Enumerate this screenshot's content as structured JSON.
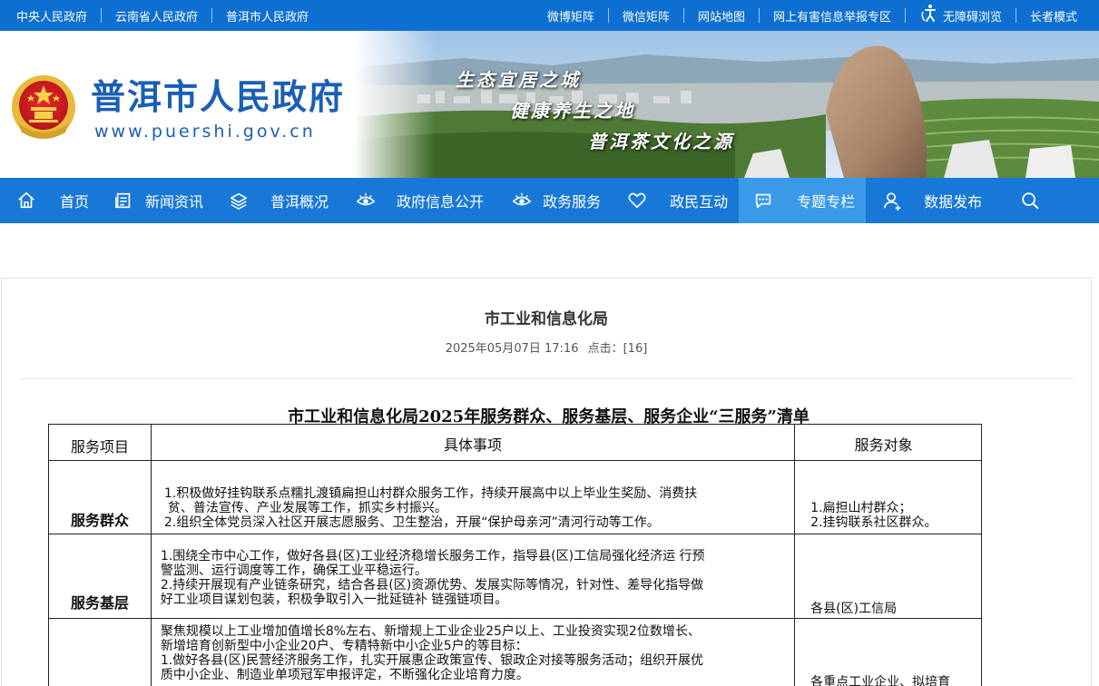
{
  "topbar": {
    "left_links": [
      "中央人民政府",
      "云南省人民政府",
      "普洱市人民政府"
    ],
    "right_links": [
      "微博矩阵",
      "微信矩阵",
      "网站地图",
      "网上有害信息举报专区"
    ],
    "accessibility": "无障碍浏览",
    "elder_mode": "长者模式"
  },
  "header": {
    "site_title": "普洱市人民政府",
    "site_url": "www.puershi.gov.cn",
    "slogans": [
      "生态宜居之城",
      "健康养生之地",
      "普洱茶文化之源"
    ]
  },
  "nav": {
    "items": [
      {
        "label": "首页",
        "icon": "home-icon"
      },
      {
        "label": "新闻资讯",
        "icon": "news-icon"
      },
      {
        "label": "普洱概况",
        "icon": "layers-icon"
      },
      {
        "label": "政府信息公开",
        "icon": "eye-icon"
      },
      {
        "label": "政务服务",
        "icon": "eye-icon"
      },
      {
        "label": "政民互动",
        "icon": "heart-icon"
      },
      {
        "label": "专题专栏",
        "icon": "chat-icon"
      },
      {
        "label": "数据发布",
        "icon": "user-icon"
      }
    ],
    "active_index": 6,
    "search_icon": "search-icon"
  },
  "article": {
    "title": "市工业和信息化局",
    "date": "2025年05月07日 17:16",
    "clicks_label": "点击：[16]"
  },
  "document": {
    "title": "市工业和信息化局2025年服务群众、服务基层、服务企业“三服务”清单",
    "headers": [
      "服务项目",
      "具体事项",
      "服务对象"
    ],
    "rows": [
      {
        "item": "服务群众",
        "details": [
          "1.积极做好挂钩联系点糯扎渡镇扁担山村群众服务工作，持续开展高中以上毕业生奖励、消费扶",
          "贫、普法宣传、产业发展等工作，抓实乡村振兴。",
          "2.组织全体党员深入社区开展志愿服务、卫生整治，开展“保护母亲河”清河行动等工作。"
        ],
        "targets": [
          "1.扁担山村群众；",
          "2.挂钩联系社区群众。"
        ]
      },
      {
        "item": "服务基层",
        "details": [
          "1.围绕全市中心工作，做好各县(区)工业经济稳增长服务工作，指导县(区)工信局强化经济运 行预",
          "警监测、运行调度等工作，确保工业平稳运行。",
          "2.持续开展现有产业链条研究，结合各县(区)资源优势、发展实际等情况，针对性、差导化指导做",
          "好工业项目谋划包装，积极争取引入一批延链补 链强链项目。"
        ],
        "targets": [
          "各县(区)工信局"
        ]
      },
      {
        "item": "",
        "details": [
          "聚焦规模以上工业增加值增长8%左右、新增规上工业企业25户以上、工业投资实现2位数增长、",
          "新增培育创新型中小企业20户、专精特新中小企业5户的等目标：",
          "1.做好各县(区)民营经济服务工作，扎实开展惠企政策宣传、银政企对接等服务活动；组织开展优",
          "质中小企业、制造业单项冠军申报评定，不断强化企业培育力度。"
        ],
        "targets": [
          "各重点工业企业、拟培育"
        ]
      }
    ]
  },
  "colors": {
    "topbar": "#0d6fd1",
    "nav": "#1878d7",
    "nav_active": "#3a9ae8",
    "title_blue": "#1a5fb4"
  }
}
